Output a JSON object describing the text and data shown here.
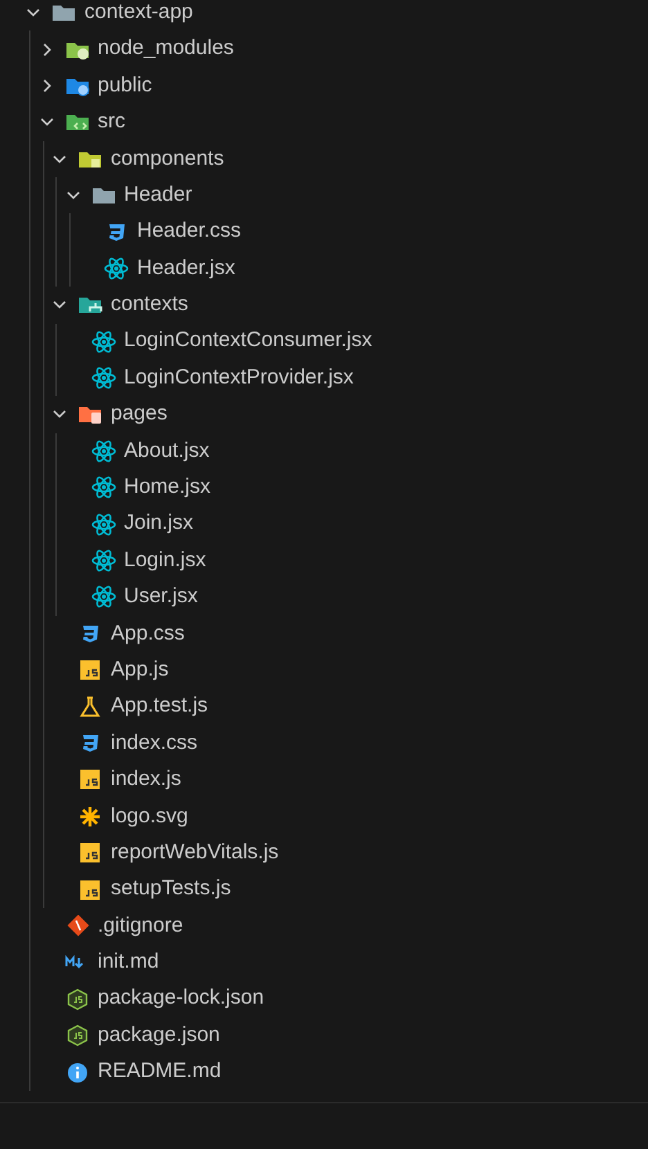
{
  "tree": [
    {
      "label": "context-app",
      "kind": "folder",
      "expanded": true,
      "children": [
        {
          "label": "node_modules",
          "kind": "nodefolder",
          "expanded": false
        },
        {
          "label": "public",
          "kind": "webfolder",
          "expanded": false
        },
        {
          "label": "src",
          "kind": "srcfolder",
          "expanded": true,
          "children": [
            {
              "label": "components",
              "kind": "compfolder",
              "expanded": true,
              "children": [
                {
                  "label": "Header",
                  "kind": "folder",
                  "expanded": true,
                  "children": [
                    {
                      "label": "Header.css",
                      "kind": "css"
                    },
                    {
                      "label": "Header.jsx",
                      "kind": "react"
                    }
                  ]
                }
              ]
            },
            {
              "label": "contexts",
              "kind": "ctxfolder",
              "expanded": true,
              "children": [
                {
                  "label": "LoginContextConsumer.jsx",
                  "kind": "react"
                },
                {
                  "label": "LoginContextProvider.jsx",
                  "kind": "react"
                }
              ]
            },
            {
              "label": "pages",
              "kind": "pagefolder",
              "expanded": true,
              "children": [
                {
                  "label": "About.jsx",
                  "kind": "react"
                },
                {
                  "label": "Home.jsx",
                  "kind": "react"
                },
                {
                  "label": "Join.jsx",
                  "kind": "react"
                },
                {
                  "label": "Login.jsx",
                  "kind": "react"
                },
                {
                  "label": "User.jsx",
                  "kind": "react"
                }
              ]
            },
            {
              "label": "App.css",
              "kind": "css"
            },
            {
              "label": "App.js",
              "kind": "js"
            },
            {
              "label": "App.test.js",
              "kind": "test"
            },
            {
              "label": "index.css",
              "kind": "css"
            },
            {
              "label": "index.js",
              "kind": "js"
            },
            {
              "label": "logo.svg",
              "kind": "svg"
            },
            {
              "label": "reportWebVitals.js",
              "kind": "js"
            },
            {
              "label": "setupTests.js",
              "kind": "js"
            }
          ]
        },
        {
          "label": ".gitignore",
          "kind": "git"
        },
        {
          "label": "init.md",
          "kind": "md"
        },
        {
          "label": "package-lock.json",
          "kind": "nodejson"
        },
        {
          "label": "package.json",
          "kind": "nodejson"
        },
        {
          "label": "README.md",
          "kind": "info"
        }
      ]
    }
  ]
}
